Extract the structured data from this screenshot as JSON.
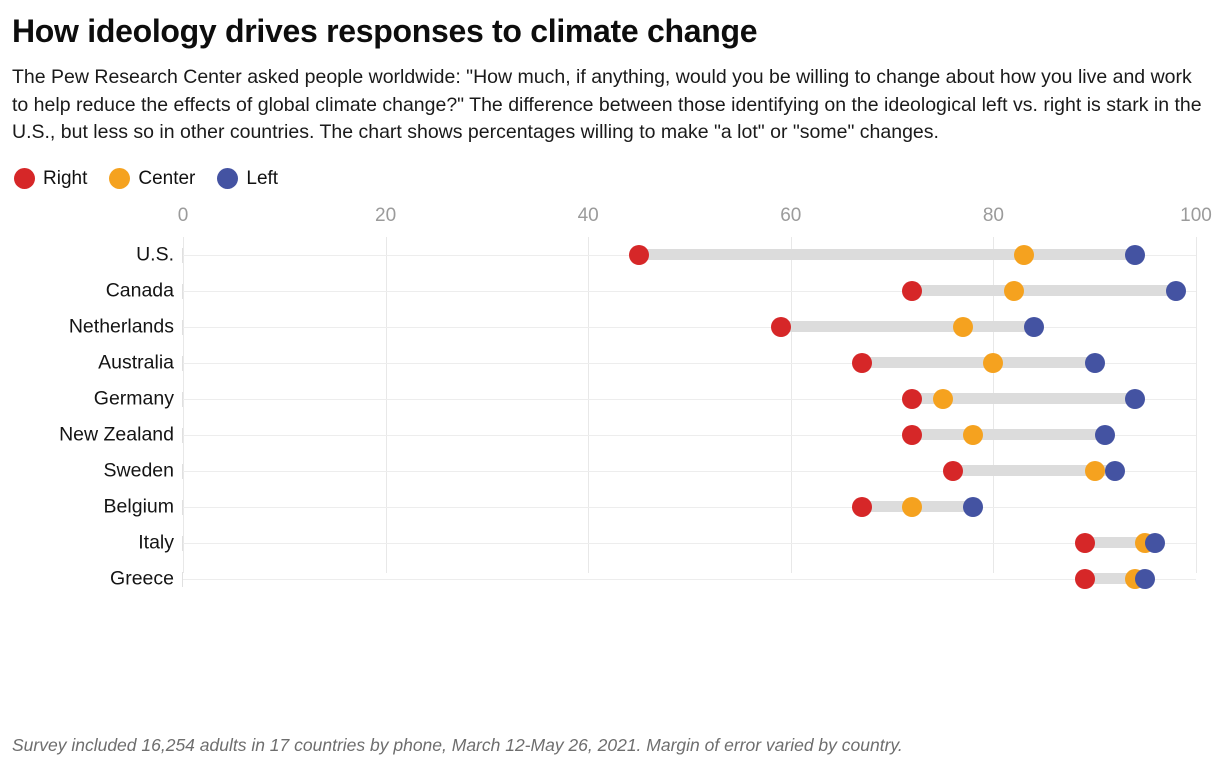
{
  "header": {
    "title": "How ideology drives responses to climate change",
    "subtitle": "The Pew Research Center asked people worldwide: \"How much, if anything, would you be willing to change about how you live and work to help reduce the effects of global climate change?\" The difference between those identifying on the ideological left vs. right is stark in the U.S., but less so in other countries. The chart shows percentages willing to make \"a lot\" or \"some\" changes."
  },
  "footnote": "Survey included 16,254 adults in 17 countries by phone, March 12-May 26, 2021. Margin of error varied by country.",
  "colors": {
    "right": "#d62728",
    "center": "#f5a21f",
    "left": "#4453a2",
    "connector": "#dcdcdc",
    "grid": "#e8e8e8",
    "tick_text": "#9b9b9b",
    "footnote_text": "#6e6e6e"
  },
  "legend": {
    "position": "top-left",
    "items": [
      {
        "label": "Right",
        "color_key": "right"
      },
      {
        "label": "Center",
        "color_key": "center"
      },
      {
        "label": "Left",
        "color_key": "left"
      }
    ]
  },
  "chart_data": {
    "type": "scatter",
    "subtype": "dumbbell-dot-plot",
    "title": "How ideology drives responses to climate change",
    "xlabel": "",
    "ylabel": "",
    "xlim": [
      0,
      100
    ],
    "xticks": [
      0,
      20,
      40,
      60,
      80,
      100
    ],
    "xtick_labels": [
      "0",
      "20",
      "40",
      "60",
      "80",
      "100"
    ],
    "grid": "vertical-and-horizontal-light",
    "unit": "percent",
    "categories": [
      "U.S.",
      "Canada",
      "Netherlands",
      "Australia",
      "Germany",
      "New Zealand",
      "Sweden",
      "Belgium",
      "Italy",
      "Greece"
    ],
    "series": [
      {
        "name": "Right",
        "color_key": "right",
        "values": [
          45,
          72,
          59,
          67,
          72,
          72,
          76,
          67,
          89,
          89
        ]
      },
      {
        "name": "Center",
        "color_key": "center",
        "values": [
          83,
          82,
          77,
          80,
          75,
          78,
          90,
          72,
          95,
          94
        ]
      },
      {
        "name": "Left",
        "color_key": "left",
        "values": [
          94,
          98,
          84,
          90,
          94,
          91,
          92,
          78,
          96,
          95
        ]
      }
    ]
  }
}
